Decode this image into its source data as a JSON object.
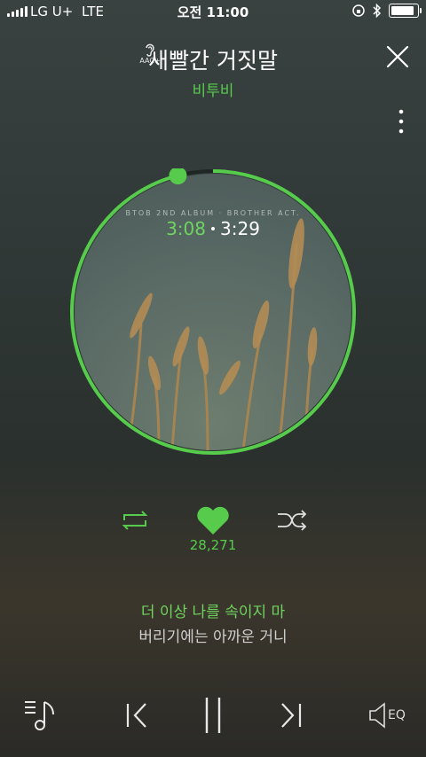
{
  "status_bar": {
    "carrier": "LG U+",
    "network": "LTE",
    "time": "오전 11:00",
    "battery_level": 0.95
  },
  "header": {
    "quality_badge": "AAC+",
    "song_title": "새빨간 거짓말",
    "artist": "비투비"
  },
  "album": {
    "label_text": "BTOB 2ND ALBUM · BROTHER ACT.",
    "current_time": "3:08",
    "total_time": "3:29",
    "progress": 0.96
  },
  "actions": {
    "like_count": "28,271"
  },
  "lyrics": {
    "current_line": "더 이상 나를 속이지 마",
    "next_line": "버리기에는 아까운 거니"
  },
  "player": {
    "eq_label": "EQ"
  },
  "colors": {
    "accent": "#57cc4c"
  }
}
